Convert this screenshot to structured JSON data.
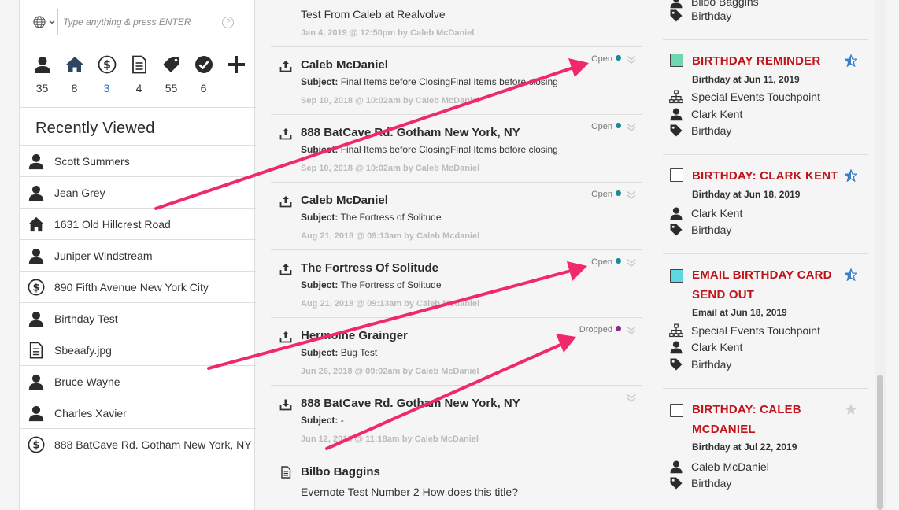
{
  "search": {
    "placeholder": "Type anything & press ENTER",
    "help": "?"
  },
  "stats": [
    {
      "icon": "person-icon",
      "count": "35"
    },
    {
      "icon": "home-icon",
      "count": "8"
    },
    {
      "icon": "dollar-icon",
      "count": "3",
      "highlight": "#2a6eb8"
    },
    {
      "icon": "document-icon",
      "count": "4"
    },
    {
      "icon": "tags-icon",
      "count": "55"
    },
    {
      "icon": "checkmark-icon",
      "count": "6"
    },
    {
      "icon": "plus-icon",
      "count": ""
    }
  ],
  "recently_viewed": {
    "title": "Recently Viewed",
    "items": [
      {
        "icon": "person-icon",
        "label": "Scott Summers"
      },
      {
        "icon": "person-icon",
        "label": "Jean Grey"
      },
      {
        "icon": "home-icon",
        "label": "1631 Old Hillcrest Road"
      },
      {
        "icon": "person-icon",
        "label": "Juniper Windstream"
      },
      {
        "icon": "dollar-icon",
        "label": "890 Fifth Avenue New York City"
      },
      {
        "icon": "person-icon",
        "label": "Birthday Test"
      },
      {
        "icon": "document-icon",
        "label": "Sbeaafy.jpg"
      },
      {
        "icon": "person-icon",
        "label": "Bruce Wayne"
      },
      {
        "icon": "person-icon",
        "label": "Charles Xavier"
      },
      {
        "icon": "dollar-icon",
        "label": "888 BatCave Rd. Gotham New York, NY"
      }
    ]
  },
  "feed": [
    {
      "icon": "upload-icon",
      "title": "",
      "body": "Test From Caleb at Realvolve",
      "subject_label": "",
      "meta": "Jan 4, 2019 @ 12:50pm by Caleb McDaniel",
      "status": "",
      "status_color": ""
    },
    {
      "icon": "upload-icon",
      "title": "Caleb McDaniel",
      "subject_label": "Subject:",
      "body": "Final Items before ClosingFinal Items before closing",
      "meta": "Sep 10, 2018 @ 10:02am by Caleb McDaniel",
      "status": "Open",
      "status_color": "#1a8a96"
    },
    {
      "icon": "upload-icon",
      "title": "888 BatCave Rd. Gotham New York, NY",
      "subject_label": "Subject:",
      "body": "Final Items before ClosingFinal Items before closing",
      "meta": "Sep 10, 2018 @ 10:02am by Caleb McDaniel",
      "status": "Open",
      "status_color": "#1a8a96"
    },
    {
      "icon": "upload-icon",
      "title": "Caleb McDaniel",
      "subject_label": "Subject:",
      "body": "The Fortress of Solitude",
      "meta": "Aug 21, 2018 @ 09:13am by Caleb Mcdaniel",
      "status": "Open",
      "status_color": "#1a8a96"
    },
    {
      "icon": "upload-icon",
      "title": "The Fortress Of Solitude",
      "subject_label": "Subject:",
      "body": "The Fortress of Solitude",
      "meta": "Aug 21, 2018 @ 09:13am by Caleb Mcdaniel",
      "status": "Open",
      "status_color": "#1a8a96"
    },
    {
      "icon": "upload-icon",
      "title": "Hermoine Grainger",
      "subject_label": "Subject:",
      "body": "Bug Test",
      "meta": "Jun 26, 2018 @ 09:02am by Caleb McDaniel",
      "status": "Dropped",
      "status_color": "#8e2b8e"
    },
    {
      "icon": "download-icon",
      "title": "888 BatCave Rd. Gotham New York, NY",
      "subject_label": "Subject:",
      "body": "-",
      "meta": "Jun 12, 2018 @ 11:18am by Caleb McDaniel",
      "status": "",
      "status_color": ""
    },
    {
      "icon": "document-icon",
      "title": "Bilbo Baggins",
      "subject_label": "",
      "body": "Evernote Test Number 2 How does this title?",
      "meta": "",
      "status": "",
      "status_color": ""
    }
  ],
  "events": [
    {
      "title": "",
      "sub": "",
      "rows": [
        {
          "icon": "person-icon",
          "label": "Bilbo Baggins"
        },
        {
          "icon": "tag-icon",
          "label": "Birthday"
        }
      ]
    },
    {
      "title": "BIRTHDAY REMINDER",
      "box_color": "#6fd8b0",
      "star": "blue",
      "sub": "Birthday at Jun 11, 2019",
      "rows": [
        {
          "icon": "org-chart-icon",
          "label": "Special Events Touchpoint"
        },
        {
          "icon": "person-icon",
          "label": "Clark Kent"
        },
        {
          "icon": "tag-icon",
          "label": "Birthday"
        }
      ]
    },
    {
      "title": "BIRTHDAY: CLARK KENT",
      "box_color": "#ffffff",
      "star": "blue",
      "sub": "Birthday at Jun 18, 2019",
      "rows": [
        {
          "icon": "person-icon",
          "label": "Clark Kent"
        },
        {
          "icon": "tag-icon",
          "label": "Birthday"
        }
      ]
    },
    {
      "title": "EMAIL BIRTHDAY CARD SEND OUT",
      "box_color": "#5fd6e0",
      "star": "blue",
      "sub": "Email at Jun 18, 2019",
      "rows": [
        {
          "icon": "org-chart-icon",
          "label": "Special Events Touchpoint"
        },
        {
          "icon": "person-icon",
          "label": "Clark Kent"
        },
        {
          "icon": "tag-icon",
          "label": "Birthday"
        }
      ]
    },
    {
      "title": "BIRTHDAY: CALEB MCDANIEL",
      "box_color": "#ffffff",
      "star": "gray",
      "sub": "Birthday at Jul 22, 2019",
      "rows": [
        {
          "icon": "person-icon",
          "label": "Caleb McDaniel"
        },
        {
          "icon": "tag-icon",
          "label": "Birthday"
        }
      ]
    }
  ],
  "colors": {
    "accent_red": "#c0141b",
    "arrow": "#f0286c",
    "link_blue": "#2a6eb8"
  }
}
